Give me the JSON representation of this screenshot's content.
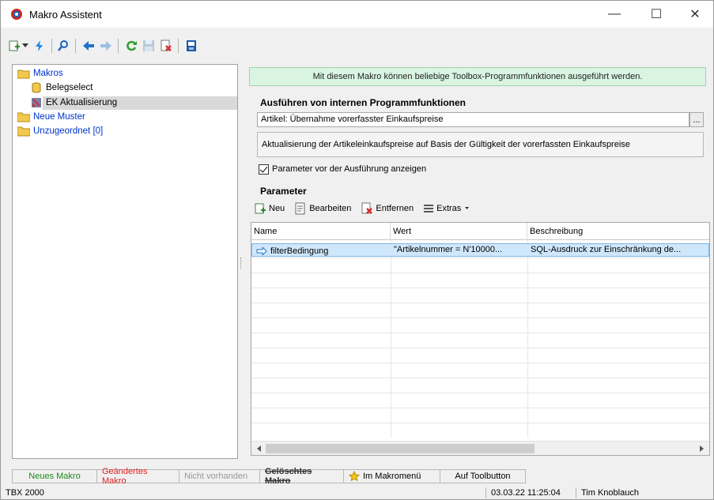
{
  "window": {
    "title": "Makro Assistent",
    "minimize": "—",
    "maximize": "☐",
    "close": "✕"
  },
  "tree": {
    "items": [
      {
        "label": "Makros",
        "icon": "folder-icon",
        "level": 0
      },
      {
        "label": "Belegselect",
        "icon": "database-icon",
        "level": 1
      },
      {
        "label": "EK Aktualisierung",
        "icon": "macro-icon",
        "level": 1,
        "selected": true
      },
      {
        "label": "Neue Muster",
        "icon": "folder-icon",
        "level": 0
      },
      {
        "label": "Unzugeordnet [0]",
        "icon": "folder-icon",
        "level": 0
      }
    ]
  },
  "info_banner": "Mit diesem Makro können beliebige Toolbox-Programmfunktionen ausgeführt werden.",
  "exec_section": {
    "label": "Ausführen von internen Programmfunktionen",
    "function_value": "Artikel: Übernahme vorerfasster Einkaufspreise",
    "browse_label": "...",
    "description": "Aktualisierung der Artikeleinkaufspreise auf Basis der Gültigkeit der vorerfassten Einkaufspreise",
    "checkbox_label": "Parameter vor der Ausführung anzeigen",
    "checkbox_checked": true
  },
  "params_section": {
    "label": "Parameter",
    "toolbar": {
      "new": "Neu",
      "edit": "Bearbeiten",
      "remove": "Entfernen",
      "extras": "Extras"
    },
    "columns": [
      "Name",
      "Wert",
      "Beschreibung"
    ],
    "rows": [
      {
        "name": "filterBedingung",
        "value": "\"Artikelnummer = N'10000...",
        "description": "SQL-Ausdruck zur Einschränkung de..."
      }
    ]
  },
  "legend": {
    "new": "Neues Makro",
    "changed": "Geändertes Makro",
    "missing": "Nicht vorhanden",
    "deleted": "Gelöschtes Makro",
    "menu": "Im Makromenü",
    "toolbutton": "Auf Toolbutton"
  },
  "status": {
    "app": "TBX 2000",
    "timestamp": "03.03.22 11:25:04",
    "user": "Tim Knoblauch"
  },
  "colors": {
    "legend_new": "#1f8a1f",
    "legend_changed": "#e02020",
    "legend_missing": "#9a9a9a",
    "banner_bg": "#d9f5e2",
    "selection_bg": "#cfe7fb",
    "tree_text": "#0033cc"
  }
}
